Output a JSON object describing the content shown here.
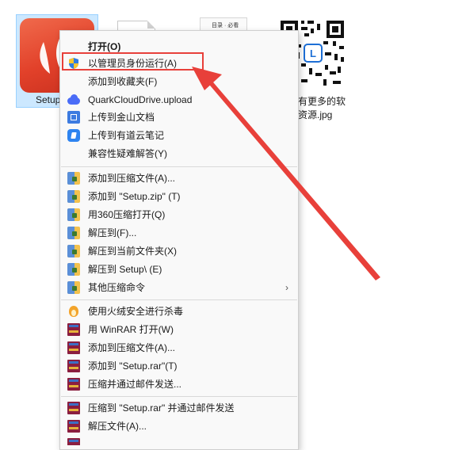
{
  "desktop": {
    "files": [
      {
        "label": "Setup",
        "icon": "app-leaf-icon",
        "selected": true
      },
      {
        "label": "",
        "icon": "document-icon"
      },
      {
        "label": "",
        "icon": "paper-icon",
        "thumb_title": "目录 · 必看"
      },
      {
        "label_line1": "有更多的软",
        "label_line2": "资源.jpg",
        "icon": "qr-code-icon"
      }
    ]
  },
  "menu": {
    "items": [
      {
        "label": "打开(O)",
        "icon": "",
        "bold": true
      },
      {
        "label": "以管理员身份运行(A)",
        "icon": "uac-shield-icon",
        "highlighted": true
      },
      {
        "label": "添加到收藏夹(F)",
        "icon": ""
      },
      {
        "label": "QuarkCloudDrive.upload",
        "icon": "quark-cloud-icon"
      },
      {
        "label": "上传到金山文档",
        "icon": "kdocs-icon"
      },
      {
        "label": "上传到有道云笔记",
        "icon": "youdao-note-icon"
      },
      {
        "label": "兼容性疑难解答(Y)",
        "icon": ""
      },
      {
        "label": "添加到压缩文件(A)...",
        "icon": "zip-archive-icon"
      },
      {
        "label": "添加到 \"Setup.zip\" (T)",
        "icon": "zip-archive-icon"
      },
      {
        "label": "用360压缩打开(Q)",
        "icon": "zip-archive-icon"
      },
      {
        "label": "解压到(F)...",
        "icon": "zip-archive-icon"
      },
      {
        "label": "解压到当前文件夹(X)",
        "icon": "zip-archive-icon"
      },
      {
        "label": "解压到 Setup\\ (E)",
        "icon": "zip-archive-icon"
      },
      {
        "label": "其他压缩命令",
        "icon": "zip-archive-icon",
        "submenu": true
      },
      {
        "label": "使用火绒安全进行杀毒",
        "icon": "huorong-fire-icon"
      },
      {
        "label": "用 WinRAR 打开(W)",
        "icon": "winrar-icon"
      },
      {
        "label": "添加到压缩文件(A)...",
        "icon": "winrar-icon"
      },
      {
        "label": "添加到 \"Setup.rar\"(T)",
        "icon": "winrar-icon"
      },
      {
        "label": "压缩并通过邮件发送...",
        "icon": "winrar-icon"
      },
      {
        "label": "压缩到 \"Setup.rar\" 并通过邮件发送",
        "icon": "winrar-icon"
      },
      {
        "label": "解压文件(A)...",
        "icon": "winrar-icon"
      }
    ],
    "submenu_arrow": "›"
  },
  "annotation": {
    "color": "#e8403a"
  }
}
